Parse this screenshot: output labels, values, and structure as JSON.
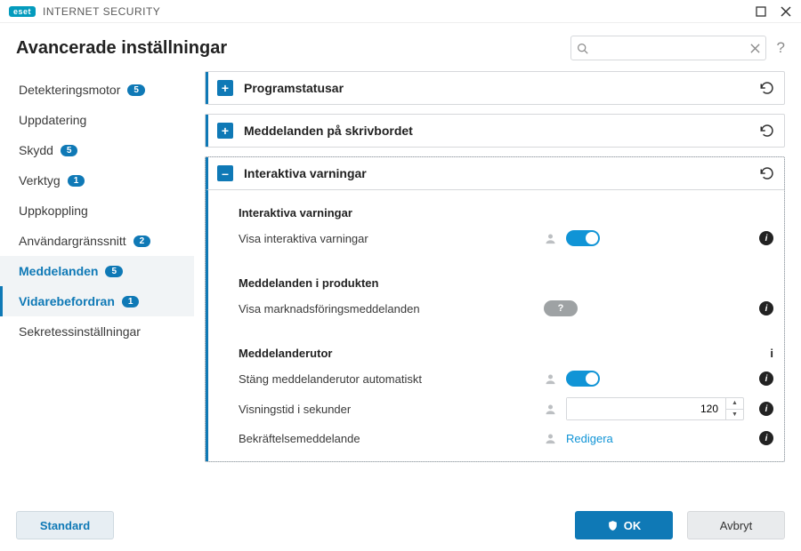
{
  "brand": {
    "logo": "eset",
    "product": "INTERNET SECURITY"
  },
  "window": {
    "title": "Avancerade inställningar",
    "search_placeholder": ""
  },
  "sidebar": {
    "items": [
      {
        "label": "Detekteringsmotor",
        "badge": "5"
      },
      {
        "label": "Uppdatering"
      },
      {
        "label": "Skydd",
        "badge": "5"
      },
      {
        "label": "Verktyg",
        "badge": "1"
      },
      {
        "label": "Uppkoppling"
      },
      {
        "label": "Användargränssnitt",
        "badge": "2"
      },
      {
        "label": "Meddelanden",
        "badge": "5"
      },
      {
        "label": "Vidarebefordran",
        "badge": "1"
      },
      {
        "label": "Sekretessinställningar"
      }
    ]
  },
  "groups": {
    "g0": {
      "title": "Programstatusar"
    },
    "g1": {
      "title": "Meddelanden på skrivbordet"
    },
    "g2": {
      "title": "Interaktiva varningar",
      "sec0": {
        "title": "Interaktiva varningar",
        "row0": {
          "label": "Visa interaktiva varningar"
        }
      },
      "sec1": {
        "title": "Meddelanden i produkten",
        "row0": {
          "label": "Visa marknadsföringsmeddelanden"
        }
      },
      "sec2": {
        "title": "Meddelanderutor",
        "row0": {
          "label": "Stäng meddelanderutor automatiskt"
        },
        "row1": {
          "label": "Visningstid i sekunder",
          "value": "120"
        },
        "row2": {
          "label": "Bekräftelsemeddelande",
          "action": "Redigera"
        }
      }
    }
  },
  "footer": {
    "default": "Standard",
    "ok": "OK",
    "cancel": "Avbryt"
  },
  "icons": {
    "expand": "+",
    "collapse": "–",
    "unknown": "?"
  }
}
